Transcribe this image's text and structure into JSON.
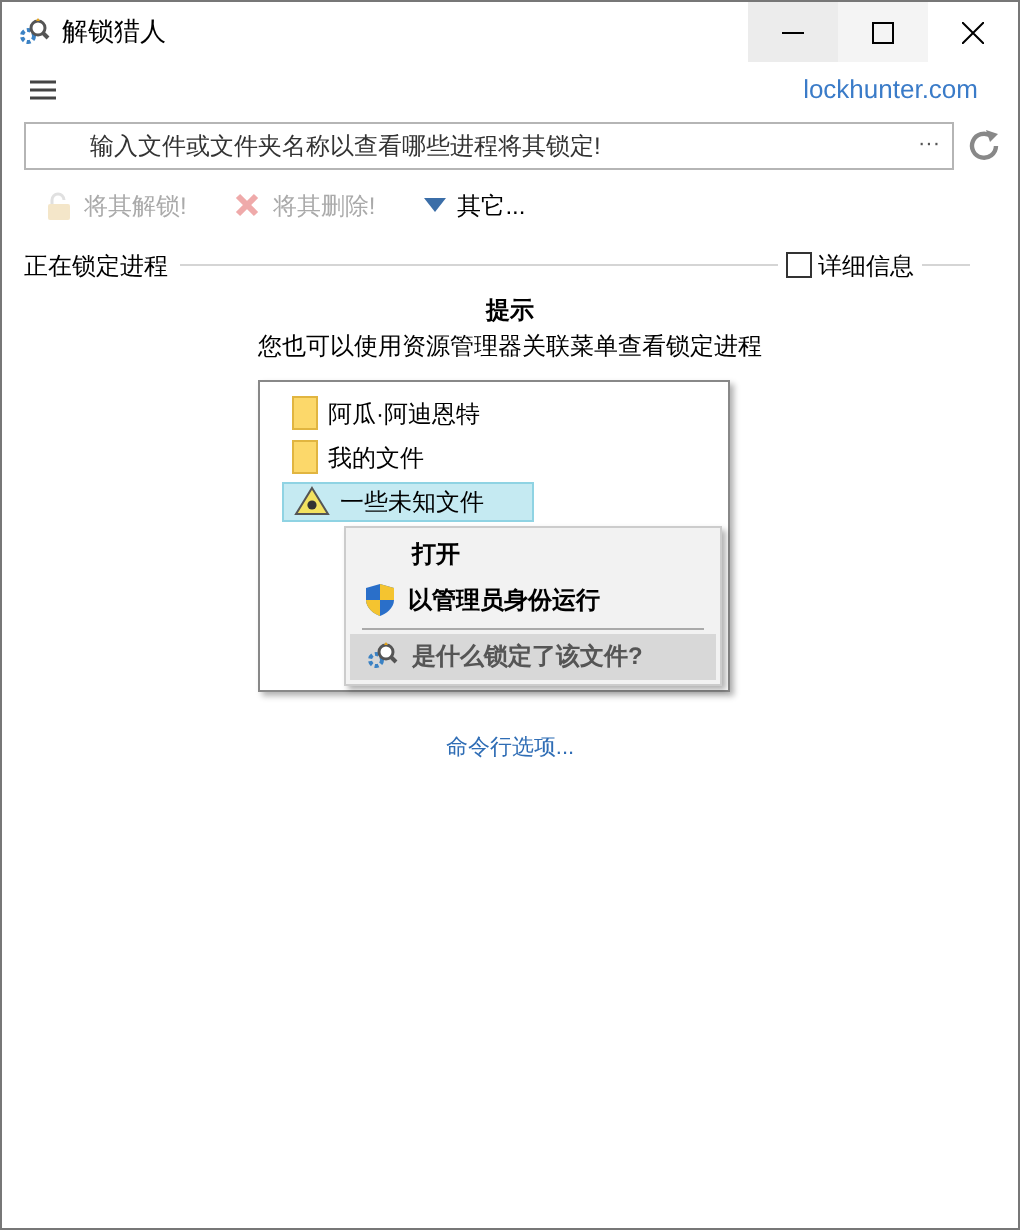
{
  "window": {
    "title": "解锁猎人"
  },
  "link": "lockhunter.com",
  "path_field": {
    "placeholder": "输入文件或文件夹名称以查看哪些进程将其锁定!",
    "browse": "···"
  },
  "toolbar": [
    {
      "kind": "unlock",
      "label": "将其解锁!",
      "disabled": true
    },
    {
      "kind": "delete",
      "label": "将其删除!",
      "disabled": true
    },
    {
      "kind": "other",
      "label": "其它...",
      "disabled": false
    }
  ],
  "section": {
    "title": "正在锁定进程",
    "details": {
      "label": "详细信息",
      "checked": false
    }
  },
  "hint": {
    "title": "提示",
    "text": "您也可以使用资源管理器关联菜单查看锁定进程",
    "files": [
      {
        "kind": "folder",
        "name": "阿瓜·阿迪恩特",
        "selected": false
      },
      {
        "kind": "folder",
        "name": "我的文件",
        "selected": false
      },
      {
        "kind": "hazard",
        "name": "一些未知文件",
        "selected": true
      }
    ],
    "menu": [
      {
        "kind": "plain",
        "label": "打开",
        "selected": false
      },
      {
        "kind": "shield",
        "label": "以管理员身份运行",
        "selected": false
      },
      {
        "kind": "lockhunter",
        "label": "是什么锁定了该文件?",
        "selected": true
      }
    ]
  },
  "cmd_link": "命令行选项..."
}
